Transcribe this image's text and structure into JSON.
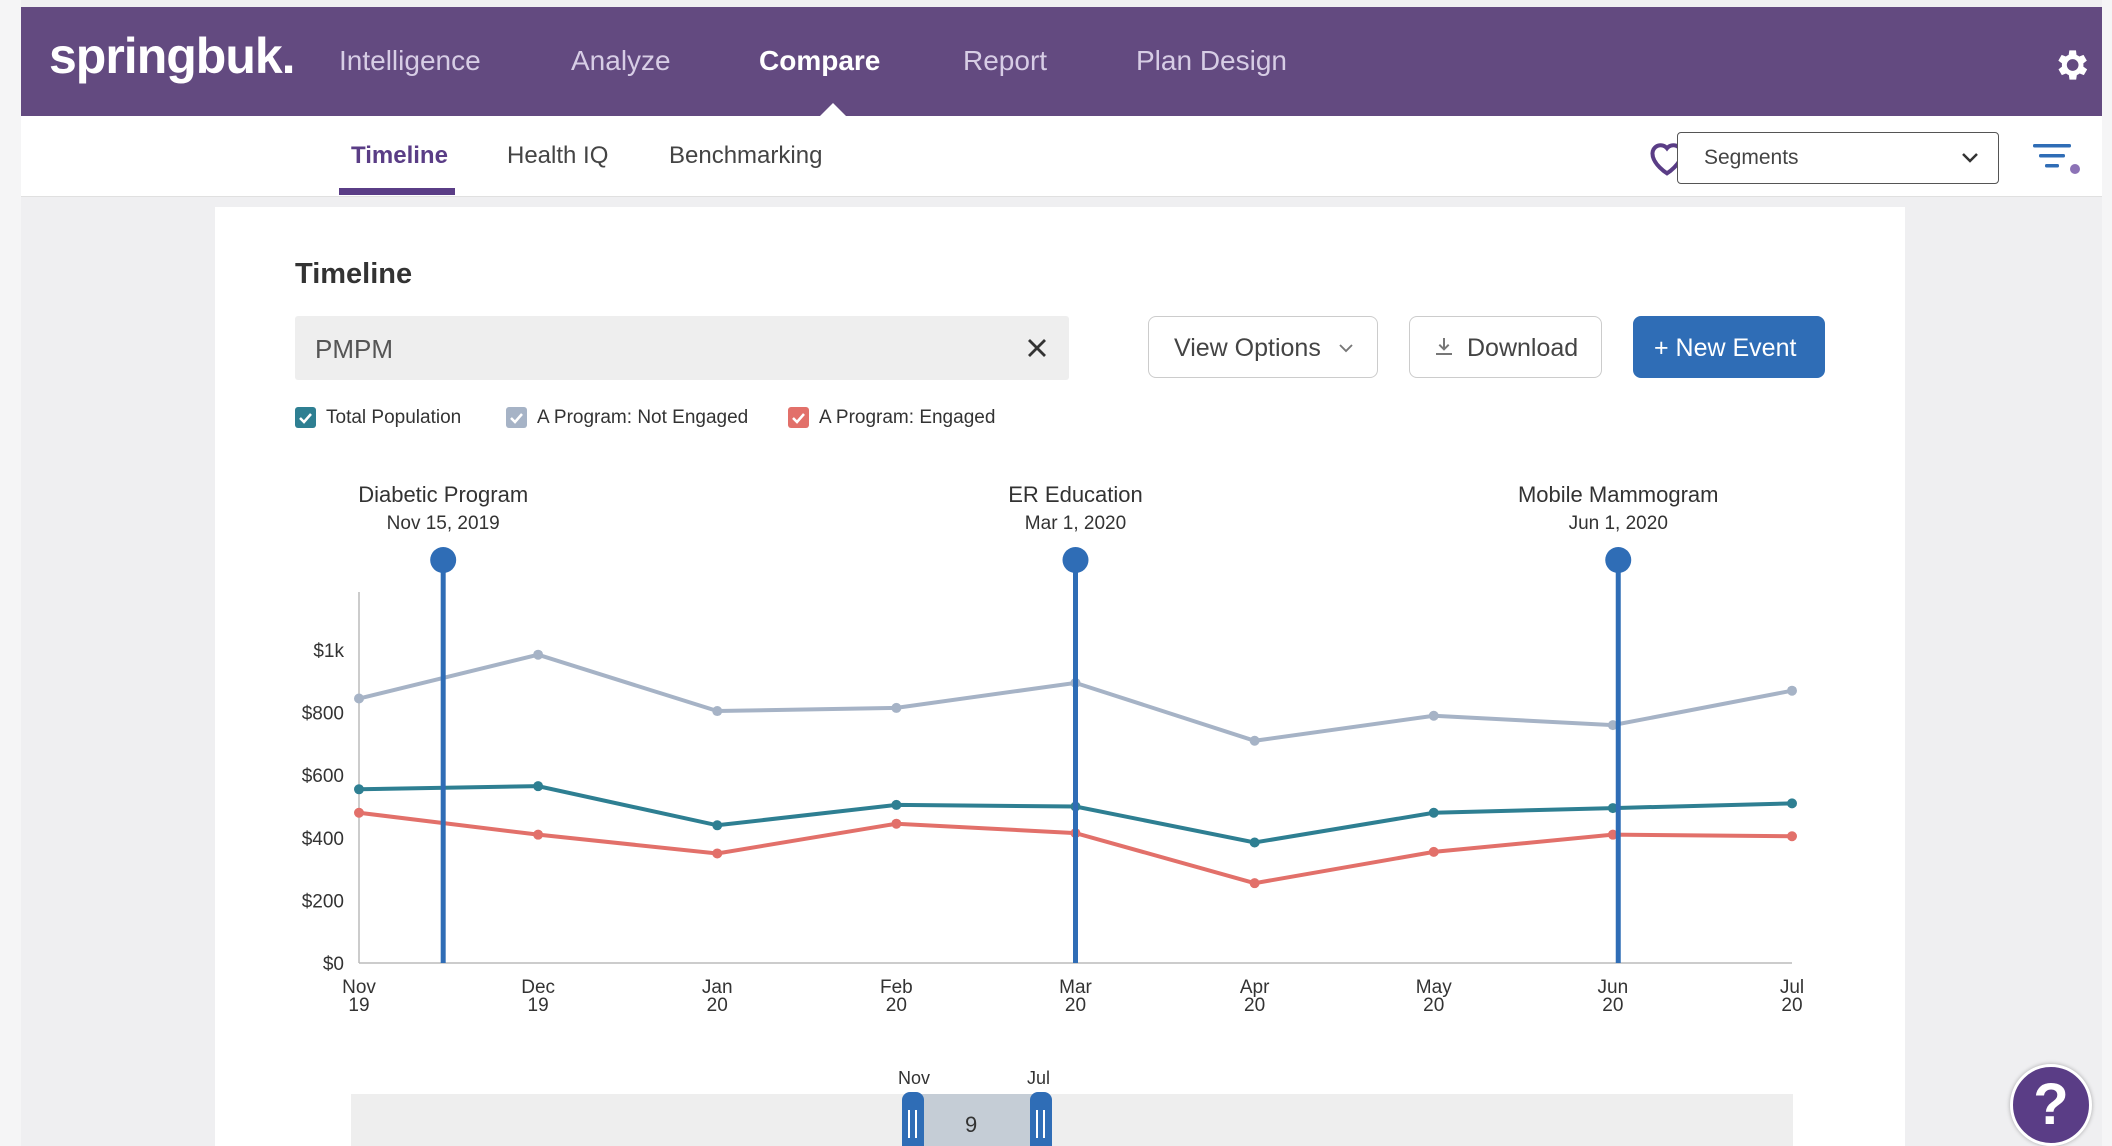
{
  "app": {
    "logo": "springbuk.",
    "nav": [
      "Intelligence",
      "Analyze",
      "Compare",
      "Report",
      "Plan Design"
    ],
    "active_nav": "Compare"
  },
  "subnav": {
    "tabs": [
      "Timeline",
      "Health IQ",
      "Benchmarking"
    ],
    "active": "Timeline",
    "segments_label": "Segments"
  },
  "page": {
    "title": "Timeline",
    "metric_value": "PMPM",
    "view_options_label": "View Options",
    "download_label": "Download",
    "new_event_label": "+ New Event"
  },
  "legend": [
    {
      "label": "Total Population",
      "color": "#2e7f92"
    },
    {
      "label": "A Program: Not Engaged",
      "color": "#9aa9c0"
    },
    {
      "label": "A Program: Engaged",
      "color": "#e2706a"
    }
  ],
  "chart_data": {
    "type": "line",
    "x": [
      "Nov 19",
      "Dec 19",
      "Jan 20",
      "Feb 20",
      "Mar 20",
      "Apr 20",
      "May 20",
      "Jun 20",
      "Jul 20"
    ],
    "y_ticks": [
      "$0",
      "$200",
      "$400",
      "$600",
      "$800",
      "$1k"
    ],
    "ylim": [
      0,
      1000
    ],
    "series": [
      {
        "name": "A Program: Not Engaged",
        "color": "#a6b3c6",
        "values": [
          845,
          985,
          805,
          815,
          895,
          710,
          790,
          760,
          870
        ]
      },
      {
        "name": "Total Population",
        "color": "#2e7f92",
        "values": [
          555,
          565,
          440,
          505,
          500,
          385,
          480,
          495,
          510
        ]
      },
      {
        "name": "A Program: Engaged",
        "color": "#e2706a",
        "values": [
          480,
          410,
          350,
          445,
          415,
          255,
          355,
          410,
          405
        ]
      }
    ],
    "events": [
      {
        "name": "Diabetic Program",
        "date": "Nov 15, 2019",
        "x_pos": 0.47
      },
      {
        "name": "ER Education",
        "date": "Mar 1, 2020",
        "x_pos": 4.0
      },
      {
        "name": "Mobile Mammogram",
        "date": "Jun 1, 2020",
        "x_pos": 7.03
      }
    ]
  },
  "range_slider": {
    "start_label": "Nov",
    "end_label": "Jul",
    "count": "9"
  },
  "help_label": "?"
}
